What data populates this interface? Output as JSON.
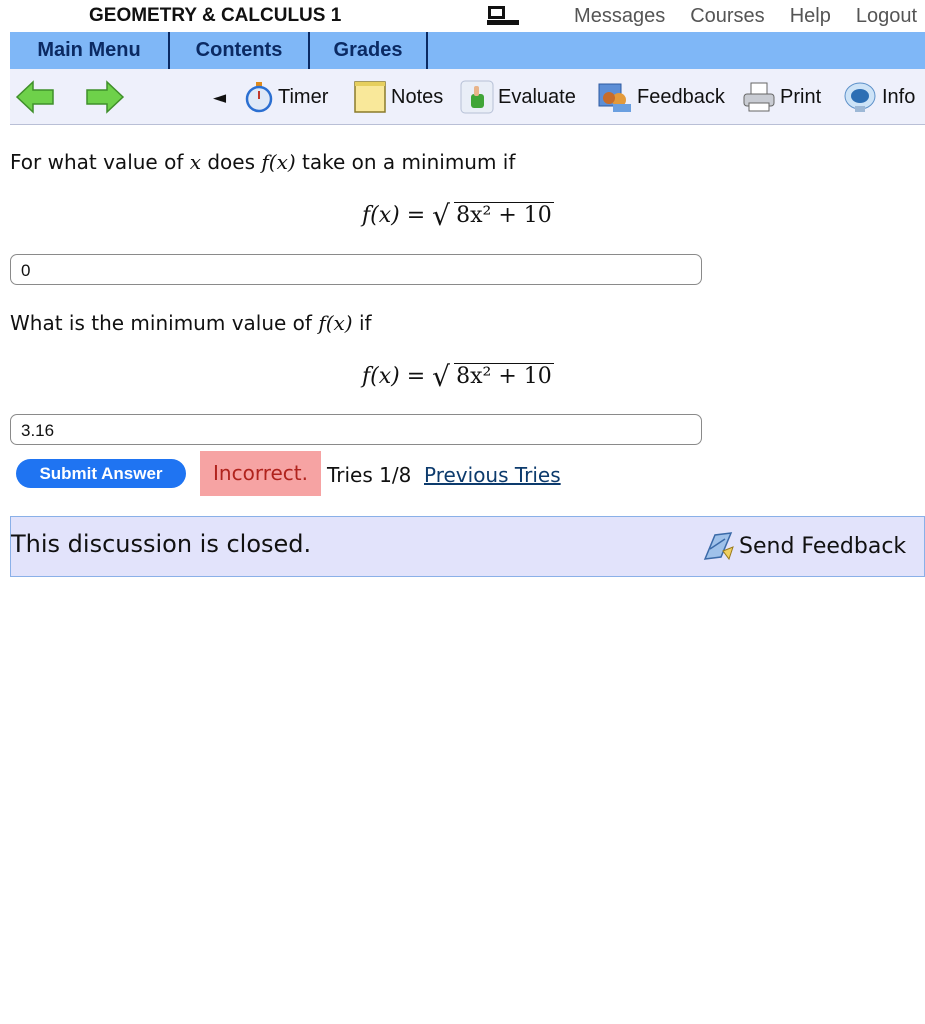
{
  "header": {
    "course_title": "GEOMETRY & CALCULUS 1",
    "links": [
      "Messages",
      "Courses",
      "Help",
      "Logout"
    ]
  },
  "nav": {
    "tabs": [
      "Main Menu",
      "Contents",
      "Grades"
    ]
  },
  "toolbar": {
    "back_glyph": "◄",
    "items": [
      "Timer",
      "Notes",
      "Evaluate",
      "Feedback",
      "Print",
      "Info"
    ]
  },
  "question1": {
    "prefix": "For what value of ",
    "var": "x",
    "middle": " does ",
    "func": "f(x)",
    "suffix": " take on a minimum if",
    "formula_lhs": "f(x) = ",
    "formula_radicand": "8x² + 10",
    "answer": "0"
  },
  "question2": {
    "prefix": "What is the minimum value of ",
    "func": "f(x)",
    "suffix": " if",
    "formula_lhs": "f(x) = ",
    "formula_radicand": "8x² + 10",
    "answer": "3.16"
  },
  "submission": {
    "submit_label": "Submit Answer",
    "status": "Incorrect.",
    "tries": "Tries 1/8",
    "previous_tries": "Previous Tries"
  },
  "discussion": {
    "text": "This discussion is closed.",
    "send_feedback": "Send Feedback"
  }
}
